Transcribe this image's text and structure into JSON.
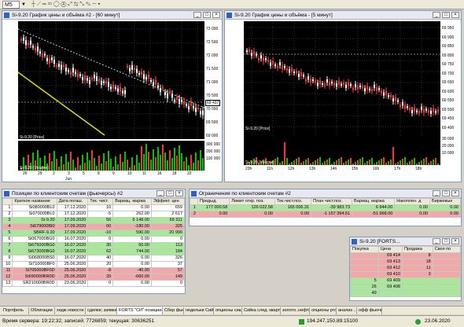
{
  "toolbar": {
    "selector": "M5"
  },
  "chart_left": {
    "title": "Si-9.20 График цены и объёма #2 - [60 минут]",
    "price_label": "Si-9.20 [Price]",
    "volume_label": "Si-9.20 [Volume]",
    "y_ticks": [
      "73 000",
      "72 500",
      "72 000",
      "71 500",
      "71 000",
      "70 500",
      "70 000",
      "69 500",
      "69 000"
    ],
    "current_price": "69 437",
    "vol_ticks": [
      "300 000",
      "200 000",
      "100 000"
    ],
    "x_ticks": [
      "26",
      "29",
      "2",
      "3",
      "5",
      "8",
      "9",
      "10",
      "11",
      "16",
      "18",
      "22"
    ],
    "x_month": "Jun"
  },
  "chart_right": {
    "title": "Si-9.20 График цены и объёма - [5 минут]",
    "price_label": "Si-9.20 [Price]",
    "volume_label": "Si-9.20 [Volume]",
    "y_ticks": [
      "69 950",
      "69 900",
      "69 850",
      "69 800",
      "69 750",
      "69 700",
      "69 650",
      "69 600",
      "69 550",
      "69 500",
      "69 450",
      "69 400"
    ],
    "vol_ticks": [
      "30 000",
      "20 000",
      "10 000"
    ],
    "x_ticks": [
      "23h",
      "11h",
      "12h",
      "13h",
      "14h",
      "15h",
      "16h",
      "17h",
      "18h"
    ]
  },
  "positions": {
    "title": "Позиции по клиентским счетам (фьючерсы) #2",
    "headers": [
      "Краткое название",
      "Дата погаш.",
      "Тек. чист.",
      "Вариац. маржа",
      "Эффект. цен"
    ],
    "rows": [
      {
        "n": "1",
        "name": "Si080000BL0",
        "date": "17.12.2020",
        "pos": "10",
        "vm": "0.00",
        "eff": "659",
        "style": "white"
      },
      {
        "n": "2",
        "name": "Si070000BL0",
        "date": "17.12.2020",
        "pos": "-5",
        "vm": "262.00",
        "eff": "2 617",
        "style": "white"
      },
      {
        "n": "3",
        "name": "Si-9.20",
        "date": "17.09.2020",
        "pos": "56",
        "vm": "6 148.00",
        "eff": "69 311",
        "style": "green"
      },
      {
        "n": "4",
        "name": "Si679000BI0",
        "date": "17.09.2020",
        "pos": "60",
        "vm": "-180.00",
        "eff": "325",
        "style": "red"
      },
      {
        "n": "5",
        "name": "SBRF-9.20",
        "date": "17.09.2020",
        "pos": "-10",
        "vm": "590.00",
        "eff": "20 999",
        "style": "green"
      },
      {
        "n": "6",
        "name": "Si067000BG0",
        "date": "16.07.2020",
        "pos": "0",
        "vm": "0.00",
        "eff": "0",
        "style": "white"
      },
      {
        "n": "7",
        "name": "Si675000BG0",
        "date": "16.07.2020",
        "pos": "30",
        "vm": "60.00",
        "eff": "113",
        "style": "green"
      },
      {
        "n": "8",
        "name": "Si673000BG0",
        "date": "16.07.2020",
        "pos": "62",
        "vm": "744.00",
        "eff": "184",
        "style": "green"
      },
      {
        "n": "9",
        "name": "Si068000BS0",
        "date": "16.07.2020",
        "pos": "40",
        "vm": "0.00",
        "eff": "326",
        "style": "white"
      },
      {
        "n": "10",
        "name": "Si710000BF0",
        "date": "25.06.2020",
        "pos": "20",
        "vm": "0.00",
        "eff": "37",
        "style": "white"
      },
      {
        "n": "11",
        "name": "Si705000BF0D",
        "date": "25.06.2020",
        "pos": "-8",
        "vm": "-40.00",
        "eff": "57",
        "style": "red"
      },
      {
        "n": "12",
        "name": "Si690000BR0D",
        "date": "25.06.2020",
        "pos": "20",
        "vm": "-660.00",
        "eff": "149",
        "style": "red"
      },
      {
        "n": "13",
        "name": "SR210000BR0D",
        "date": "23.06.2020",
        "pos": "0",
        "vm": "0.00",
        "eff": "0",
        "style": "white"
      }
    ]
  },
  "limits": {
    "title": "Ограничения по клиентским счетам #2",
    "headers": [
      "Предыд.",
      "Лимит откр. поз.",
      "Тек.чист.поз.",
      "План чист.поз.",
      "Вариац. маржа",
      "Накоплен. д",
      "Биржевые"
    ],
    "rows": [
      {
        "n": "1",
        "prev": "177 000.58",
        "limit": "126 022.58",
        "cur": "165 006.31",
        "plan": "-39 983.73",
        "vm": "6 944.00",
        "acc": "0.00",
        "exch": "0.00",
        "style": "green"
      },
      {
        "n": "2",
        "prev": "0.00",
        "limit": "0.00",
        "cur": "0.00",
        "plan": "-1 157 394.51",
        "vm": "-51 968.00",
        "acc": "0.00",
        "exch": "0.00",
        "style": "red"
      }
    ]
  },
  "quotes": {
    "title": "Si-9.20 [FORTS...",
    "headers": [
      "Покупка",
      "Цена",
      "Продажа",
      "Своя по"
    ],
    "rows": [
      {
        "buy": "",
        "price": "69 414",
        "sell": "8",
        "own": "",
        "style": "red"
      },
      {
        "buy": "",
        "price": "69 413",
        "sell": "18",
        "own": "",
        "style": "red"
      },
      {
        "buy": "",
        "price": "69 412",
        "sell": "11",
        "own": "",
        "style": "red"
      },
      {
        "buy": "",
        "price": "69 410",
        "sell": "3",
        "own": "",
        "style": "red"
      },
      {
        "buy": "5",
        "price": "69 409",
        "sell": "",
        "own": "",
        "style": "green"
      },
      {
        "buy": "26",
        "price": "69 408",
        "sell": "",
        "own": "",
        "style": "green"
      },
      {
        "buy": "49",
        "price": "",
        "sell": "",
        "own": "",
        "style": "green"
      }
    ]
  },
  "tabs": [
    "Портфель",
    "Облигации",
    "хедж новости",
    "сделки; заявки",
    "FORTS \"СИ\" позиции...",
    "Сбер фьюч",
    "недельки Сийка",
    "опционы сишка",
    "Сийка след. квартал",
    "золото..нефть",
    "опционы ртс",
    "анализ ...",
    "офф фьючи"
  ],
  "status": {
    "server_time": "Время сервера: 19:22:32; записей: 7726859; текущая: 30636251",
    "connection": "194.247.150.89:15100",
    "date": "23.06.2020"
  }
}
